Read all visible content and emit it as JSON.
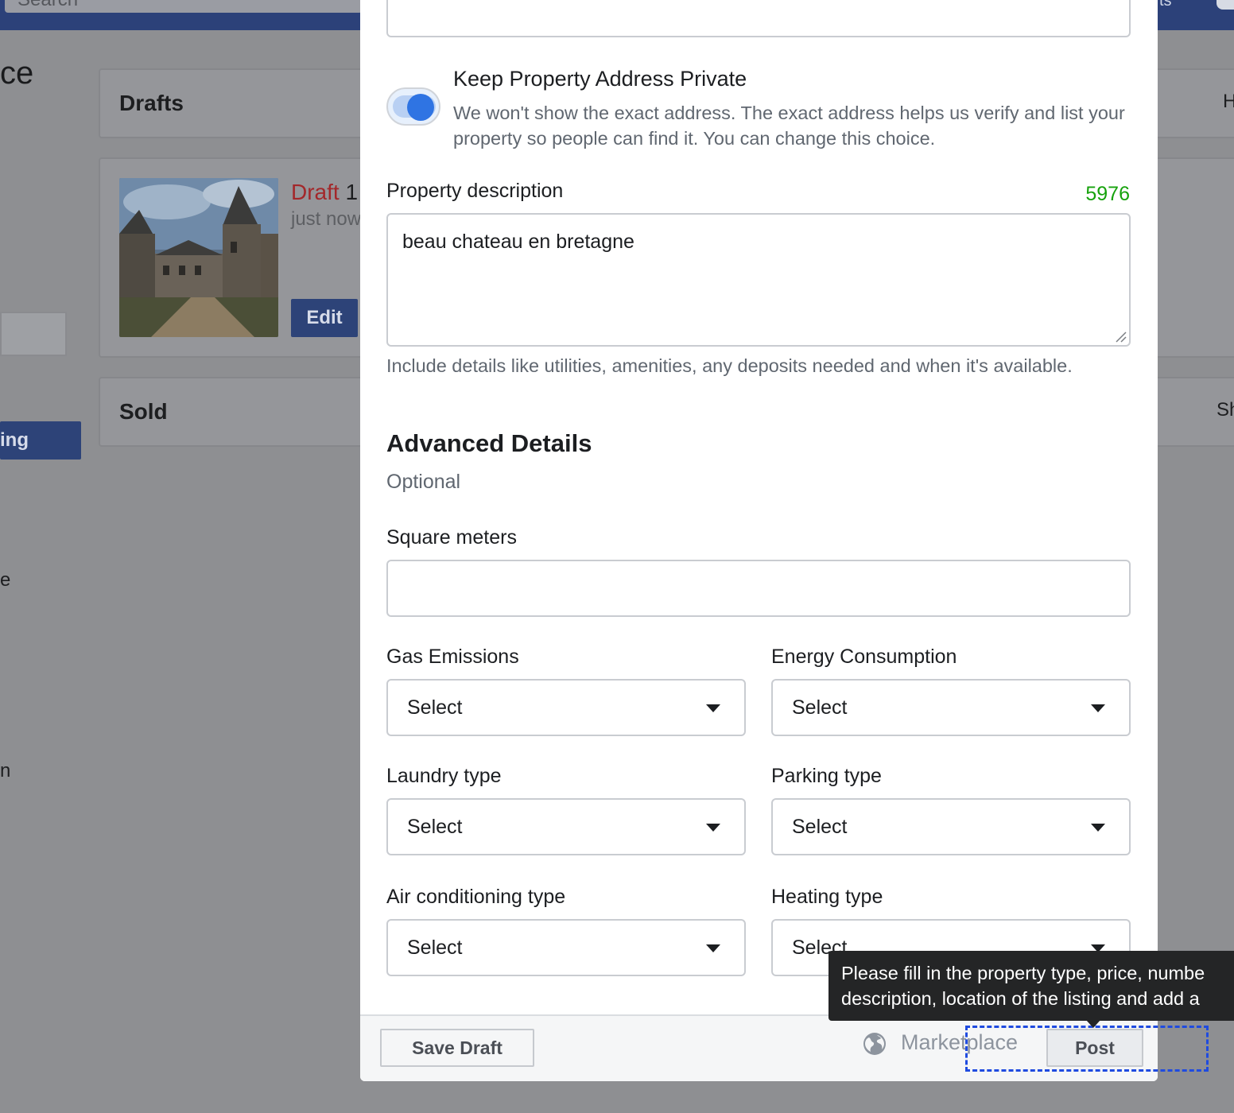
{
  "background": {
    "search_placeholder": "Search",
    "page_title": "ce",
    "drafts_label": "Drafts",
    "sold_label": "Sold",
    "draft_title": "Draft",
    "draft_title_num": "1",
    "draft_time": "just now",
    "edit_label": "Edit",
    "left_button_label": "ing",
    "left_text_1": "e",
    "left_text_2": "n",
    "right_text_1": "H",
    "right_text_2": "Sh",
    "topbar_right_text": "ts"
  },
  "modal": {
    "keep_private": {
      "title": "Keep Property Address Private",
      "description": "We won't show the exact address. The exact address helps us verify and list your property so people can find it. You can change this choice.",
      "enabled": true
    },
    "description": {
      "label": "Property description",
      "counter": "5976",
      "value": "beau chateau en bretagne",
      "help": "Include details like utilities, amenities, any deposits needed and when it's available."
    },
    "advanced": {
      "title": "Advanced Details",
      "subtitle": "Optional",
      "square_meters_label": "Square meters",
      "gas_label": "Gas Emissions",
      "energy_label": "Energy Consumption",
      "laundry_label": "Laundry type",
      "parking_label": "Parking type",
      "ac_label": "Air conditioning type",
      "heating_label": "Heating type",
      "select_value": "Select"
    },
    "footer": {
      "save_draft": "Save Draft",
      "marketplace": "Marketplace",
      "post": "Post"
    }
  },
  "tooltip": {
    "line1": "Please fill in the property type, price, numbe",
    "line2": "description, location of the listing and add a"
  },
  "colors": {
    "accent": "#2f74e3",
    "counter": "#16a20c",
    "brand_dark": "#2d4378"
  }
}
